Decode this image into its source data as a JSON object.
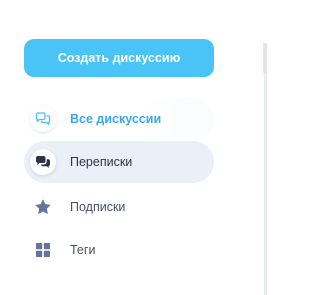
{
  "sidebar": {
    "create_button_label": "Создать дискуссию",
    "items": [
      {
        "label": "Все дискуссии",
        "icon": "comments-outline-icon",
        "active": true
      },
      {
        "label": "Переписки",
        "icon": "comments-filled-icon",
        "active": false
      },
      {
        "label": "Подписки",
        "icon": "star-icon",
        "active": false
      },
      {
        "label": "Теги",
        "icon": "tags-grid-icon",
        "active": false
      }
    ]
  },
  "colors": {
    "accent": "#4ac3f6",
    "active_text": "#3aa8e8",
    "hover_bg": "#eaeff8",
    "text": "#475066",
    "icon_muted": "#66739a"
  }
}
